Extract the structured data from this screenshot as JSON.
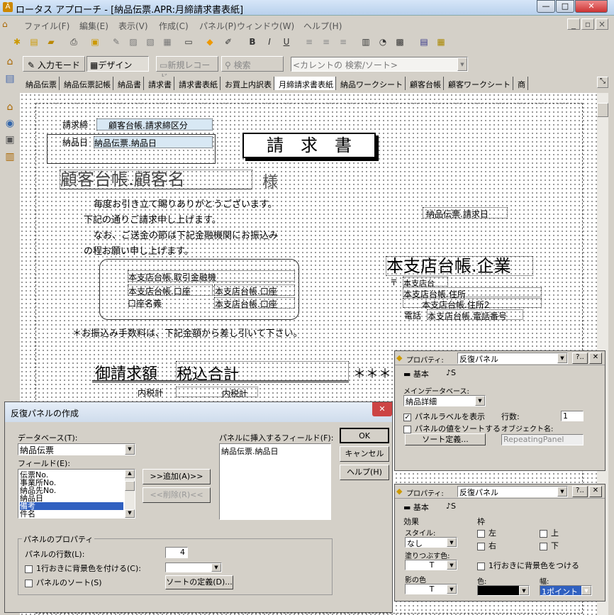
{
  "window": {
    "title": "ロータス アプローチ - [納品伝票.APR:月締請求書表紙]",
    "min": "—",
    "max": "□",
    "close": "✕"
  },
  "menu": [
    "ファイル(F)",
    "編集(E)",
    "表示(V)",
    "作成(C)",
    "パネル(P)",
    "ウィンドウ(W)",
    "ヘルプ(H)"
  ],
  "mdi": {
    "min": "_",
    "restore": "▫",
    "close": "×"
  },
  "toolbar2": {
    "input_mode": "入力モード",
    "design": "デザイン",
    "new_record": "新規レコード",
    "search": "検索",
    "current_search": "<カレントの 検索/ソート>"
  },
  "tabs": [
    "納品伝票",
    "納品伝票記帳",
    "納品書",
    "請求書",
    "請求書表紙",
    "お買上内訳表",
    "月締請求書表紙",
    "納品ワークシート",
    "顧客台帳",
    "顧客ワークシート",
    "商"
  ],
  "form": {
    "bill_close_label": "請求締",
    "bill_close_field": "顧客台帳.請求締区分",
    "delivery_date_label": "納品日",
    "delivery_date_field": "納品伝票.納品日",
    "invoice_title": "請　求　書",
    "customer_name": "顧客台帳.顧客名",
    "sama": "様",
    "greeting": [
      "毎度お引き立て賜りありがとうございます。",
      "下記の通りご請求申し上げます。",
      "なお、ご送金の節は下記金融機関にお振込み",
      "の程お願い申し上げます。"
    ],
    "billing_date": "納品伝票.請求日",
    "bank_name": "本支店台帳.取引金融機",
    "bank_acct1": "本支店台帳.口座",
    "bank_acct2": "本支店台帳.口座",
    "acct_holder_label": "口座名義",
    "acct_holder": "本支店台帳.口座",
    "company": "本支店台帳.企業",
    "postal": "〒",
    "postal_field": "本支店台",
    "addr1": "本支店台帳.住所",
    "addr2": "本支店台帳.住所2",
    "tel_label": "電話",
    "tel": "本支店台帳.電話番号",
    "fee_note": "＊お振込み手数料は、下記金額から差し引いて下さい。",
    "amount_label": "御請求額",
    "amount_field": "税込合計",
    "stars": "＊＊＊",
    "tax_label": "内税計",
    "tax_field": "内税計"
  },
  "dialog_rp": {
    "title": "反復パネルの作成",
    "close": "✕",
    "db_label": "データベース(T):",
    "db_value": "納品伝票",
    "fields_label": "フィールド(E):",
    "fields": [
      "伝票No.",
      "事業所No.",
      "納品先No.",
      "納品日",
      "備考",
      "件名"
    ],
    "selected_field": "備考",
    "add": ">>追加(A)>>",
    "remove": "<<削除(R)<<",
    "insert_label": "パネルに挿入するフィールド(F):",
    "insert_items": [
      "納品伝票.納品日"
    ],
    "ok": "OK",
    "cancel": "キャンセル",
    "help": "ヘルプ(H)",
    "props_group": "パネルのプロパティ",
    "rows_label": "パネルの行数(L):",
    "rows_value": "4",
    "alt_bg_label": "1行おきに背景色を付ける(C):",
    "sort_label": "パネルのソート(S)",
    "sort_def": "ソートの定義(D)..."
  },
  "prop1": {
    "title": "プロパティ:",
    "selector": "反復パネル",
    "q": "?..",
    "close": "✕",
    "tab_basic": "基本",
    "tab2": "♪S",
    "maindb_label": "メインデータベース:",
    "maindb_value": "納品詳細",
    "show_label": "パネルラベルを表示",
    "rows_label": "行数:",
    "rows_value": "1",
    "sort_values": "パネルの値をソートする",
    "obj_name_label": "オブジェクト名:",
    "obj_name": "RepeatingPanel",
    "sort_def": "ソート定義..."
  },
  "prop2": {
    "title": "プロパティ:",
    "selector": "反復パネル",
    "q": "?..",
    "close": "✕",
    "tab_basic": "基本",
    "tab2": "♪S",
    "effect": "効果",
    "style_label": "スタイル:",
    "style_value": "なし",
    "fill_label": "塗りつぶす色:",
    "fill_value": "T",
    "shadow_label": "影の色",
    "shadow_value": "T",
    "frame": "枠",
    "left": "左",
    "top": "上",
    "right": "右",
    "bottom": "下",
    "alt_bg": "1行おきに背景色をつける",
    "color_label": "色:",
    "width_label": "幅:",
    "width_value": "1ポイント"
  }
}
